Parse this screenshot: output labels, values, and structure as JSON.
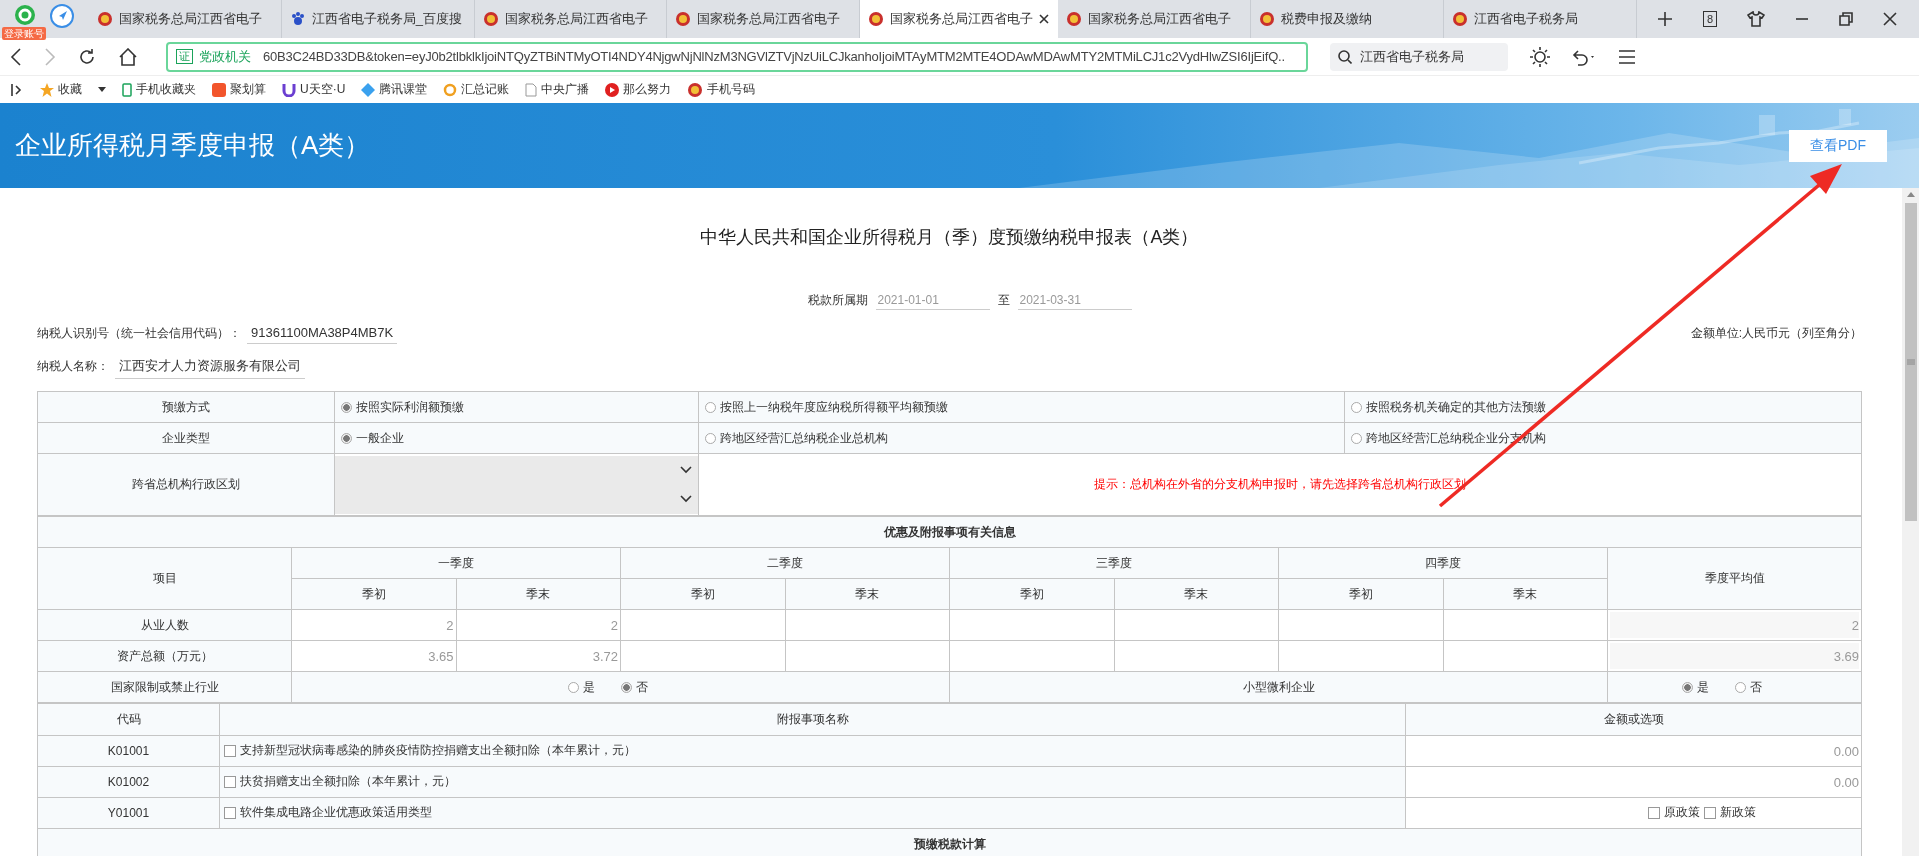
{
  "browser": {
    "login_badge": "登录账号",
    "tabs": [
      {
        "title": "国家税务总局江西省电子",
        "selected": false
      },
      {
        "title": "江西省电子税务局_百度搜",
        "selected": false
      },
      {
        "title": "国家税务总局江西省电子",
        "selected": false
      },
      {
        "title": "国家税务总局江西省电子",
        "selected": false
      },
      {
        "title": "国家税务总局江西省电子",
        "selected": true
      },
      {
        "title": "国家税务总局江西省电子",
        "selected": false
      },
      {
        "title": "税费申报及缴纳",
        "selected": false
      },
      {
        "title": "江西省电子税务局",
        "selected": false
      }
    ],
    "tab_count": "8",
    "address": {
      "badge": "证",
      "org": "党政机关",
      "url": "60B3C24BD33DB&token=eyJ0b2tlbklkIjoiNTQyZTBiNTMyOTI4NDY4NjgwNjNlNzM3NGVlZTVjNzUiLCJkanhoIjoiMTAyMTM2MTE4ODAwMDAwMTY2MTMiLCJ1c2VydHlwZSI6IjEifQ.."
    },
    "search": {
      "value": "江西省电子税务局"
    },
    "bookmarks": [
      {
        "label": "收藏"
      },
      {
        "label": "手机收藏夹"
      },
      {
        "label": "聚划算"
      },
      {
        "label": "U天空·U"
      },
      {
        "label": "腾讯课堂"
      },
      {
        "label": "汇总记账"
      },
      {
        "label": "中央广播"
      },
      {
        "label": "那么努力"
      },
      {
        "label": "手机号码"
      }
    ]
  },
  "header": {
    "title": "企业所得税月季度申报（A类）",
    "pdf_button": "查看PDF"
  },
  "form": {
    "title": "中华人民共和国企业所得税月（季）度预缴纳税申报表（A类）",
    "period": {
      "label": "税款所属期",
      "from": "2021-01-01",
      "separator": "至",
      "to": "2021-03-31"
    },
    "taxpayer_id": {
      "label": "纳税人识别号（统一社会信用代码）：",
      "value": "91361100MA38P4MB7K"
    },
    "unit": "金额单位:人民币元（列至角分）",
    "taxpayer_name": {
      "label": "纳税人名称：",
      "value": "江西安才人力资源服务有限公司"
    },
    "prepay_method": {
      "label": "预缴方式",
      "options": [
        {
          "label": "按照实际利润额预缴",
          "selected": true
        },
        {
          "label": "按照上一纳税年度应纳税所得额平均额预缴",
          "selected": false
        },
        {
          "label": "按照税务机关确定的其他方法预缴",
          "selected": false
        }
      ]
    },
    "enterprise_type": {
      "label": "企业类型",
      "options": [
        {
          "label": "一般企业",
          "selected": true
        },
        {
          "label": "跨地区经营汇总纳税企业总机构",
          "selected": false
        },
        {
          "label": "跨地区经营汇总纳税企业分支机构",
          "selected": false
        }
      ]
    },
    "cross_province": {
      "label": "跨省总机构行政区划",
      "hint": "提示：总机构在外省的分支机构申报时，请先选择跨省总机构行政区划"
    },
    "preferential": {
      "title": "优惠及附报事项有关信息",
      "item_header": "项目",
      "quarters": [
        {
          "name": "一季度",
          "start": "季初",
          "end": "季末"
        },
        {
          "name": "二季度",
          "start": "季初",
          "end": "季末"
        },
        {
          "name": "三季度",
          "start": "季初",
          "end": "季末"
        },
        {
          "name": "四季度",
          "start": "季初",
          "end": "季末"
        }
      ],
      "avg_header": "季度平均值",
      "rows": [
        {
          "label": "从业人数",
          "values": [
            "2",
            "2"
          ],
          "average": "2"
        },
        {
          "label": "资产总额（万元）",
          "values": [
            "3.65",
            "3.72"
          ],
          "average": "3.69"
        }
      ],
      "restricted": {
        "label": "国家限制或禁止行业",
        "options": [
          {
            "label": "是",
            "selected": false
          },
          {
            "label": "否",
            "selected": true
          }
        ]
      },
      "small_profit": {
        "label": "小型微利企业",
        "options": [
          {
            "label": "是",
            "selected": true
          },
          {
            "label": "否",
            "selected": false
          }
        ]
      }
    },
    "additional": {
      "headers": [
        "代码",
        "附报事项名称",
        "金额或选项"
      ],
      "rows": [
        {
          "code": "K01001",
          "name": "支持新型冠状病毒感染的肺炎疫情防控捐赠支出全额扣除（本年累计，元）",
          "checked": false,
          "kind": "amount",
          "amount": "0.00"
        },
        {
          "code": "K01002",
          "name": "扶贫捐赠支出全额扣除（本年累计，元）",
          "checked": false,
          "kind": "amount",
          "amount": "0.00"
        },
        {
          "code": "Y01001",
          "name": "软件集成电路企业优惠政策适用类型",
          "checked": false,
          "kind": "options",
          "options": [
            {
              "label": "原政策",
              "checked": false
            },
            {
              "label": "新政策",
              "checked": false
            }
          ]
        }
      ]
    },
    "calc_title": "预缴税款计算"
  }
}
